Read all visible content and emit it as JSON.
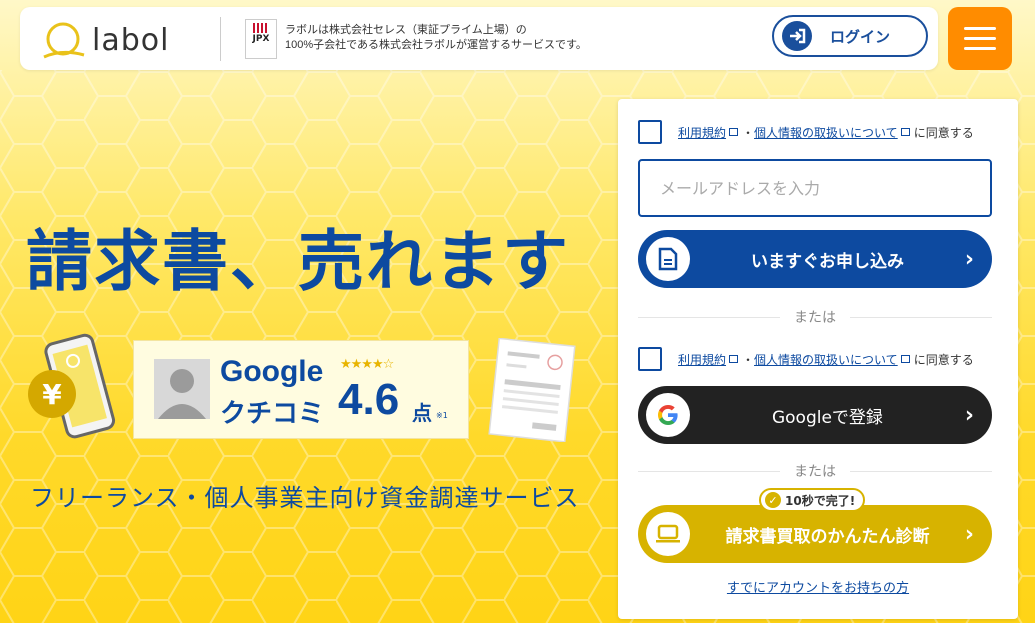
{
  "header": {
    "logo_text": "labol",
    "jpx_label": "JPX",
    "company_line1": "ラボルは株式会社セレス（東証プライム上場）の",
    "company_line2": "100%子会社である株式会社ラボルが運営するサービスです。",
    "login_label": "ログイン",
    "menu_icon": "hamburger-icon"
  },
  "hero": {
    "title": "請求書、売れます",
    "review": {
      "google": "Google",
      "kuchikomi": "クチコミ",
      "stars": "★★★★☆",
      "rating": 4.6,
      "score": "4.6",
      "unit": "点",
      "note": "※1"
    },
    "subtitle": "フリーランス・個人事業主向け資金調達サービス"
  },
  "form": {
    "terms_link": "利用規約",
    "dot": "・",
    "privacy_link": "個人情報の取扱いについて",
    "agree_text": "に同意する",
    "email_placeholder": "メールアドレスを入力",
    "apply_label": "いますぐお申し込み",
    "or_text": "または",
    "google_label": "Googleで登録",
    "badge_text": "10秒で完了!",
    "diagnose_label": "請求書買取のかんたん診断",
    "account_link": "すでにアカウントをお持ちの方"
  },
  "colors": {
    "brand_blue": "#0d4aa0",
    "accent_orange": "#ff8c00",
    "yellow": "#ffd92a",
    "dark": "#222222",
    "gold_button": "#d7b300"
  }
}
